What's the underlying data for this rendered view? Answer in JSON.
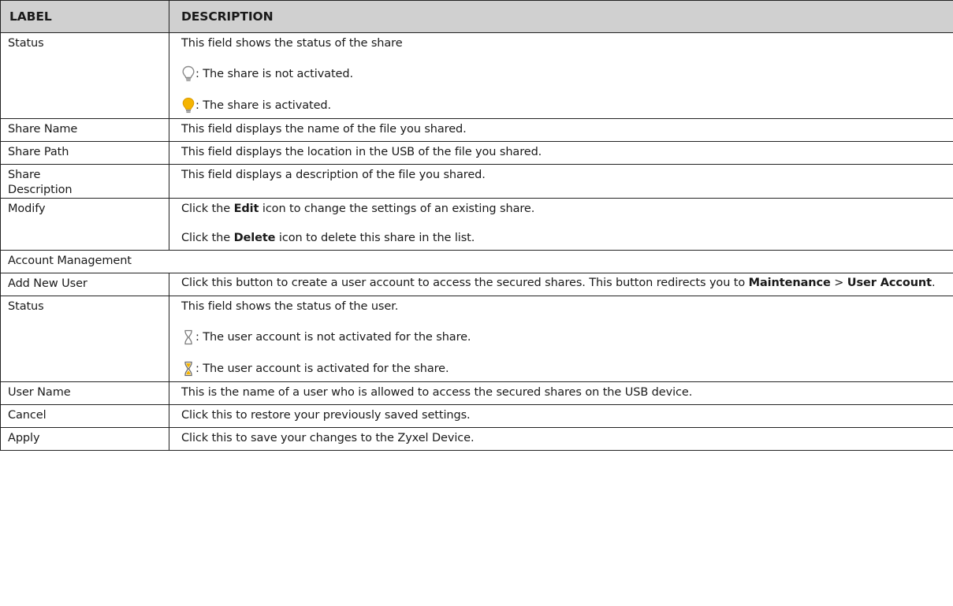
{
  "header": {
    "label": "LABEL",
    "description": "DESCRIPTION"
  },
  "rows": {
    "status1": {
      "label": "Status",
      "line1": "This field shows the status of the share",
      "line2": ": The share is not activated.",
      "line3": ": The share is activated."
    },
    "share_name": {
      "label": "Share Name",
      "desc": "This field displays the name of the file you shared."
    },
    "share_path": {
      "label": "Share Path",
      "desc": "This field displays the location in the USB of the file you shared."
    },
    "share_desc": {
      "label_line1": "Share",
      "label_line2": "Description",
      "desc": "This field displays a description of the file you shared."
    },
    "modify": {
      "label": "Modify",
      "l1_pre": "Click the ",
      "l1_bold": "Edit",
      "l1_post": " icon to change the settings of an existing share.",
      "l2_pre": "Click the ",
      "l2_bold": "Delete",
      "l2_post": " icon to delete this share in the list."
    },
    "account_mgmt": {
      "label": "Account Management"
    },
    "add_new_user": {
      "label": "Add New User",
      "pre": "Click this button to create a user account to access the secured shares. This button redirects you to ",
      "bold1": "Maintenance",
      "sep": " > ",
      "bold2": "User Account",
      "post": "."
    },
    "status2": {
      "label": "Status",
      "line1": "This field shows the status of the user.",
      "line2": ": The user account is not activated for the share.",
      "line3": ": The user account is activated for the share."
    },
    "user_name": {
      "label": "User Name",
      "desc": "This is the name of a user who is allowed to access the secured shares on the USB device."
    },
    "cancel": {
      "label": "Cancel",
      "desc": "Click this to restore your previously saved settings."
    },
    "apply": {
      "label": "Apply",
      "desc": "Click this to save your changes to the Zyxel Device."
    }
  },
  "icons": {
    "bulb_off": "lightbulb-off-icon",
    "bulb_on": "lightbulb-on-icon",
    "user_off": "user-inactive-icon",
    "user_on": "user-active-icon"
  },
  "colors": {
    "header_bg": "#d0d0d0",
    "bulb_on_fill": "#f5b400",
    "icon_grey": "#8a8a8a"
  }
}
